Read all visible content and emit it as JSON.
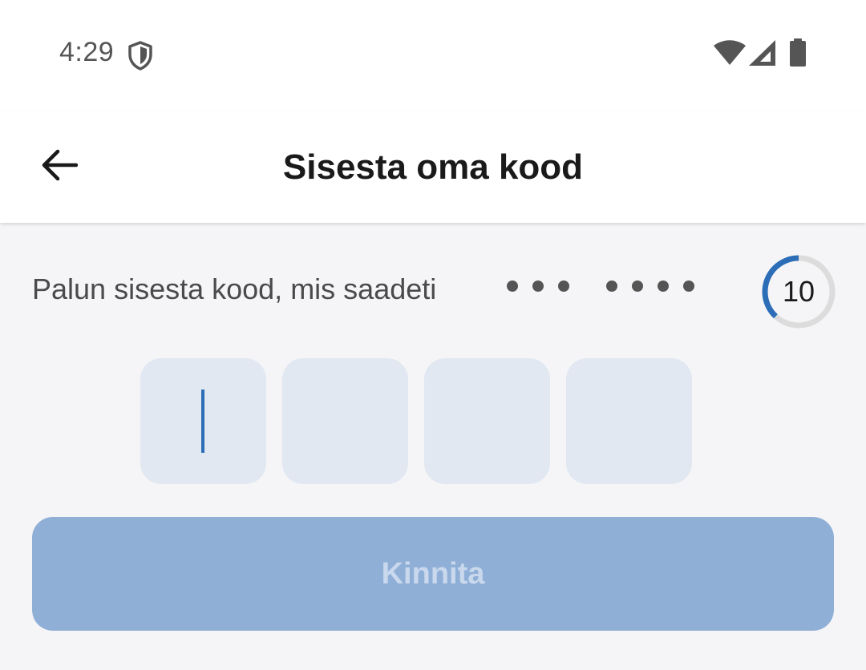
{
  "status_bar": {
    "time": "4:29",
    "icons": [
      "shield-icon",
      "wifi-icon",
      "cellular-signal-icon",
      "battery-icon"
    ]
  },
  "app_bar": {
    "back_icon": "arrow-left-icon",
    "title": "Sisesta oma kood"
  },
  "verification": {
    "instruction": "Palun sisesta kood, mis saadeti",
    "masked_destination": "••• ••••",
    "countdown": "10",
    "countdown_progress": 0.38,
    "code_length": 4,
    "code_digits": [
      "",
      "",
      "",
      ""
    ],
    "focused_index": 0
  },
  "confirm_button": {
    "label": "Kinnita",
    "enabled": false
  },
  "colors": {
    "accent": "#2c6db8",
    "button_disabled_bg": "#8fafd7",
    "button_disabled_text": "#c9d8ec",
    "code_box_bg": "#e1e8f1",
    "page_bg": "#f5f5f7"
  }
}
